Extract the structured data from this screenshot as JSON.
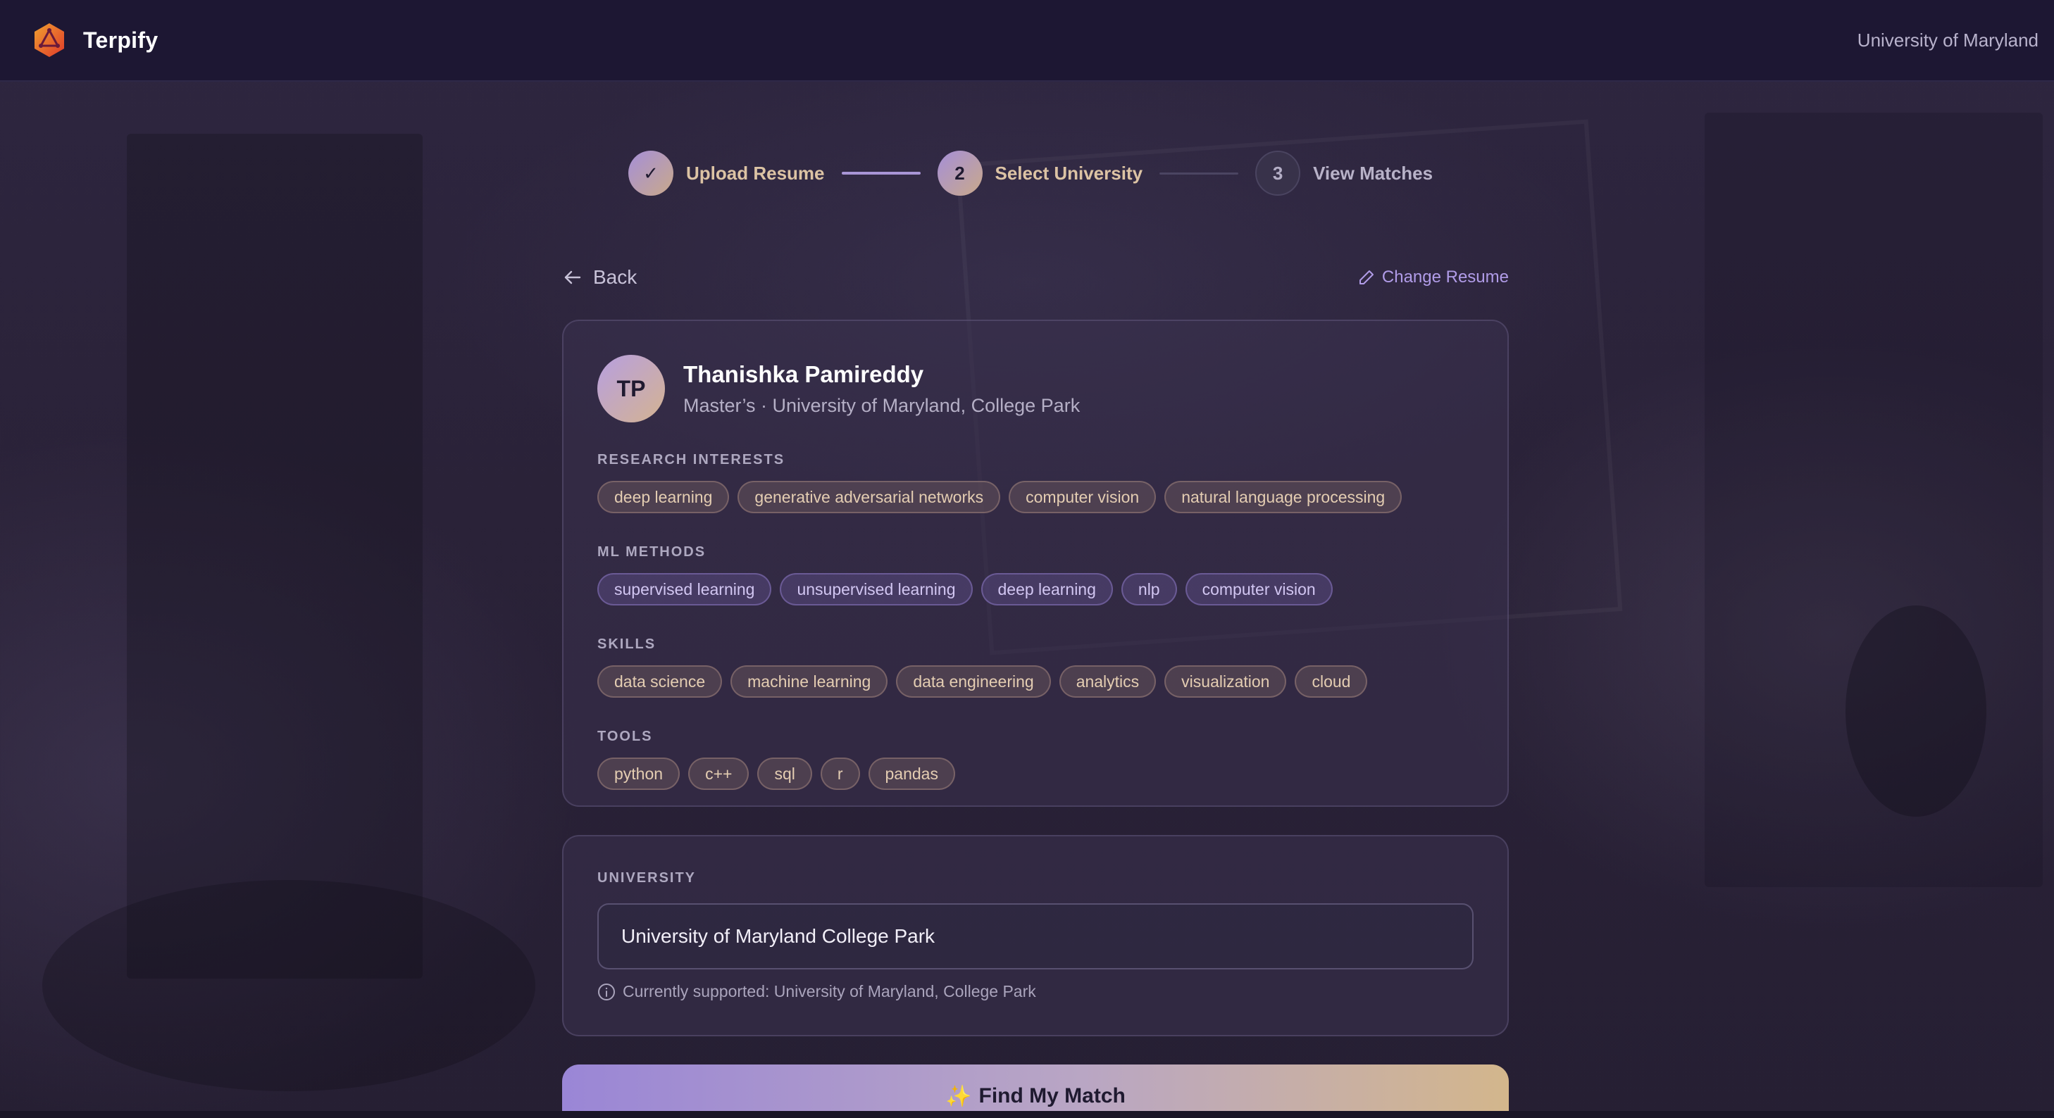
{
  "app": {
    "brand": "Terpify",
    "top_right": "University of Maryland",
    "logo_icon": "hexagon-logo-icon"
  },
  "stepper": {
    "steps": [
      {
        "marker": "✓",
        "label": "Upload Resume",
        "state": "done"
      },
      {
        "marker": "2",
        "label": "Select University",
        "state": "active"
      },
      {
        "marker": "3",
        "label": "View Matches",
        "state": "pending"
      }
    ]
  },
  "nav": {
    "back_label": "Back",
    "change_resume_label": "Change Resume"
  },
  "profile": {
    "initials": "TP",
    "name": "Thanishka Pamireddy",
    "subtitle": "Master’s · University of Maryland, College Park",
    "sections": [
      {
        "title": "RESEARCH INTERESTS",
        "style": "gold",
        "tags": [
          "deep learning",
          "generative adversarial networks",
          "computer vision",
          "natural language processing"
        ]
      },
      {
        "title": "ML METHODS",
        "style": "purple",
        "tags": [
          "supervised learning",
          "unsupervised learning",
          "deep learning",
          "nlp",
          "computer vision"
        ]
      },
      {
        "title": "SKILLS",
        "style": "gold",
        "tags": [
          "data science",
          "machine learning",
          "data engineering",
          "analytics",
          "visualization",
          "cloud"
        ]
      },
      {
        "title": "TOOLS",
        "style": "gold",
        "tags": [
          "python",
          "c++",
          "sql",
          "r",
          "pandas"
        ]
      }
    ]
  },
  "university": {
    "title": "UNIVERSITY",
    "value": "University of Maryland College Park",
    "hint": "Currently supported: University of Maryland, College Park"
  },
  "cta": {
    "sparkle": "✨",
    "label": "Find My Match"
  },
  "colors": {
    "topbar": "#1d1733",
    "accent_purple": "#a895d6",
    "accent_gold": "#dcc3a4",
    "link": "#b19ce8"
  }
}
